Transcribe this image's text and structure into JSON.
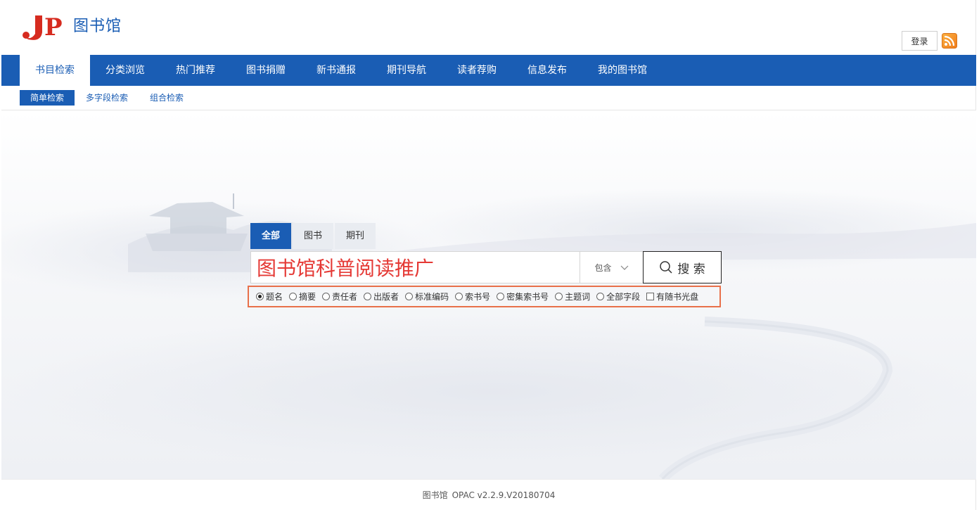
{
  "header": {
    "logo_text": "JP",
    "site_title": "图书馆",
    "login_label": "登录",
    "rss_icon": "rss-icon"
  },
  "mainnav": {
    "items": [
      {
        "label": "书目检索",
        "active": true
      },
      {
        "label": "分类浏览"
      },
      {
        "label": "热门推荐"
      },
      {
        "label": "图书捐赠"
      },
      {
        "label": "新书通报"
      },
      {
        "label": "期刊导航"
      },
      {
        "label": "读者荐购"
      },
      {
        "label": "信息发布"
      },
      {
        "label": "我的图书馆"
      }
    ]
  },
  "subnav": {
    "items": [
      {
        "label": "简单检索",
        "active": true
      },
      {
        "label": "多字段检索"
      },
      {
        "label": "组合检索"
      }
    ]
  },
  "search": {
    "tabs": [
      {
        "label": "全部",
        "active": true
      },
      {
        "label": "图书"
      },
      {
        "label": "期刊"
      }
    ],
    "query": "图书馆科普阅读推广",
    "match_mode": "包含",
    "button_label": "搜 索",
    "fields": [
      {
        "label": "题名",
        "checked": true
      },
      {
        "label": "摘要"
      },
      {
        "label": "责任者"
      },
      {
        "label": "出版者"
      },
      {
        "label": "标准编码"
      },
      {
        "label": "索书号"
      },
      {
        "label": "密集索书号"
      },
      {
        "label": "主题词"
      },
      {
        "label": "全部字段"
      }
    ],
    "checkbox_label": "有随书光盘"
  },
  "footer": {
    "name": "图书馆",
    "version": "OPAC v2.2.9.V20180704"
  },
  "colors": {
    "brand_blue": "#1a5db4",
    "logo_red": "#d62b1f",
    "highlight_orange": "#e8704a",
    "query_red": "#e53935"
  }
}
